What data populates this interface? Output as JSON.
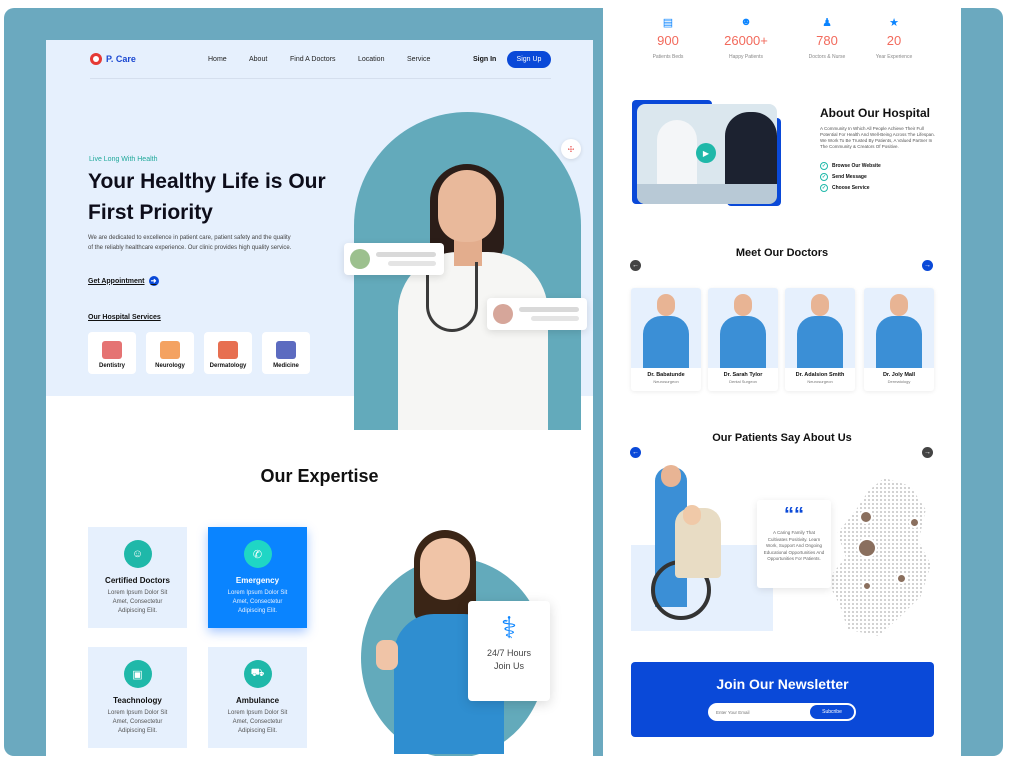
{
  "left": {
    "logo": "P. Care",
    "nav": [
      "Home",
      "About",
      "Find A Doctors",
      "Location",
      "Service"
    ],
    "signin": "Sign In",
    "signup": "Sign Up",
    "tagline": "Live Long With Health",
    "headline": "Your Healthy Life is Our First Priority",
    "lead": "We are dedicated to excellence in patient care, patient safety and the quality of the reliably healthcare experience. Our clinic provides high quality service.",
    "appointment": "Get Appointment",
    "services_title": "Our Hospital Services",
    "services": [
      {
        "label": "Dentistry",
        "color": "#e57373"
      },
      {
        "label": "Neurology",
        "color": "#f4a261"
      },
      {
        "label": "Dermatology",
        "color": "#e76f51"
      },
      {
        "label": "Medicine",
        "color": "#5c6bc0"
      }
    ],
    "expertise_title": "Our Expertise",
    "expertise": [
      {
        "title": "Certified Doctors",
        "desc": "Lorem Ipsum Dolor Sit Amet, Consectetur Adipiscing Elit."
      },
      {
        "title": "Emergency",
        "desc": "Lorem Ipsum Dolor Sit Amet, Consectetur Adipiscing Elit."
      },
      {
        "title": "Teachnology",
        "desc": "Lorem Ipsum Dolor Sit Amet, Consectetur Adipiscing Elit."
      },
      {
        "title": "Ambulance",
        "desc": "Lorem Ipsum Dolor Sit Amet, Consectetur Adipiscing Elit."
      }
    ],
    "hours_line1": "24/7 Hours",
    "hours_line2": "Join Us"
  },
  "right": {
    "stats": [
      {
        "value": "900",
        "label": "Patients Beds"
      },
      {
        "value": "26000+",
        "label": "Happy Patients"
      },
      {
        "value": "780",
        "label": "Doctors & Nurse"
      },
      {
        "value": "20",
        "label": "Year Experience"
      }
    ],
    "about_title": "About Our Hospital",
    "about_text": "A Community In Which All People Achieve Their Full Potential For Health And Well-Being Across The Lifespan. We Work To Be Trusted By Patients, A Valued Partner In The Community & Creators Of Positive.",
    "checks": [
      "Browse Our Website",
      "Send Message",
      "Choose Service"
    ],
    "doctors_title": "Meet Our Doctors",
    "doctors": [
      {
        "name": "Dr. Babatunde",
        "role": "Neurosurgeon"
      },
      {
        "name": "Dr. Sarah Tylor",
        "role": "Dental Surgeon"
      },
      {
        "name": "Dr. Adalsion Smith",
        "role": "Neurosurgeon"
      },
      {
        "name": "Dr. Joly Mall",
        "role": "Dermatology"
      }
    ],
    "patients_title": "Our Patients Say About Us",
    "quote": "A Caring Family That Cultivates Positivity. Learn Work, Support And Ongoing Educational Opportunities And Opportunities For Patients.",
    "newsletter_title": "Join Our Newsletter",
    "email_placeholder": "Enter Your Email",
    "subscribe": "Subcribe"
  },
  "colors": {
    "primary": "#0a49d8",
    "teal": "#1fb8a9",
    "stat": "#f26a5c",
    "hero_bg": "#e6f0fd",
    "frame": "#6ba9bf"
  }
}
